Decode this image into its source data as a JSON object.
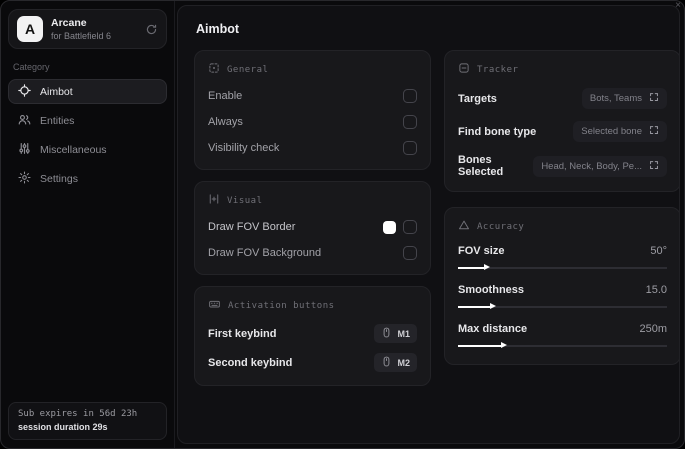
{
  "window": {
    "close_glyph": "×"
  },
  "sidebar": {
    "brand": {
      "logo_letter": "A",
      "name": "Arcane",
      "subtitle": "for Battlefield 6"
    },
    "category_label": "Category",
    "items": [
      {
        "label": "Aimbot",
        "active": true
      },
      {
        "label": "Entities",
        "active": false
      },
      {
        "label": "Miscellaneous",
        "active": false
      },
      {
        "label": "Settings",
        "active": false
      }
    ],
    "subscription": {
      "expires": "Sub expires in 56d 23h",
      "session": "session duration 29s"
    }
  },
  "main": {
    "title": "Aimbot",
    "general": {
      "title": "General",
      "rows": [
        {
          "label": "Enable",
          "checked": false
        },
        {
          "label": "Always",
          "checked": false
        },
        {
          "label": "Visibility check",
          "checked": false
        }
      ]
    },
    "visual": {
      "title": "Visual",
      "rows": [
        {
          "label": "Draw FOV Border",
          "swatch_color": "#ffffff",
          "checked": false
        },
        {
          "label": "Draw FOV Background",
          "checked": false
        }
      ]
    },
    "activation": {
      "title": "Activation buttons",
      "rows": [
        {
          "label": "First keybind",
          "key": "M1"
        },
        {
          "label": "Second keybind",
          "key": "M2"
        }
      ]
    },
    "tracker": {
      "title": "Tracker",
      "rows": [
        {
          "label": "Targets",
          "value": "Bots, Teams"
        },
        {
          "label": "Find bone type",
          "value": "Selected bone"
        },
        {
          "label": "Bones Selected",
          "value": "Head, Neck, Body, Pe..."
        }
      ]
    },
    "accuracy": {
      "title": "Accuracy",
      "sliders": [
        {
          "label": "FOV size",
          "value": "50°",
          "percent": 13
        },
        {
          "label": "Smoothness",
          "value": "15.0",
          "percent": 16
        },
        {
          "label": "Max distance",
          "value": "250m",
          "percent": 21
        }
      ]
    }
  }
}
